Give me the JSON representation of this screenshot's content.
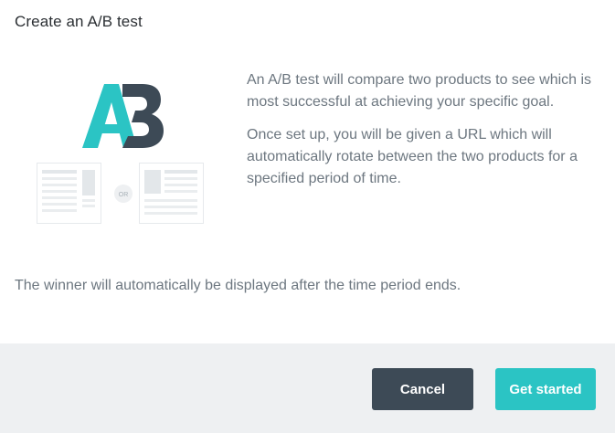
{
  "dialog": {
    "title": "Create an A/B test",
    "illustration": {
      "logo_letters": "AB",
      "or_label": "OR",
      "colors": {
        "a": "#2bc4c4",
        "b": "#3d4a56",
        "doc_line": "#dde2e6"
      }
    },
    "description": [
      "An A/B test will compare two products to see which is most successful at achieving your specific goal.",
      "Once set up, you will be given a URL which will automatically rotate between the two products for a specified period of time."
    ],
    "note": "The winner will automatically be displayed after the time period ends.",
    "buttons": {
      "cancel": "Cancel",
      "get_started": "Get started"
    },
    "colors": {
      "primary": "#2bc4c4",
      "secondary": "#3d4a56",
      "footer_bg": "#eef0f2"
    }
  }
}
